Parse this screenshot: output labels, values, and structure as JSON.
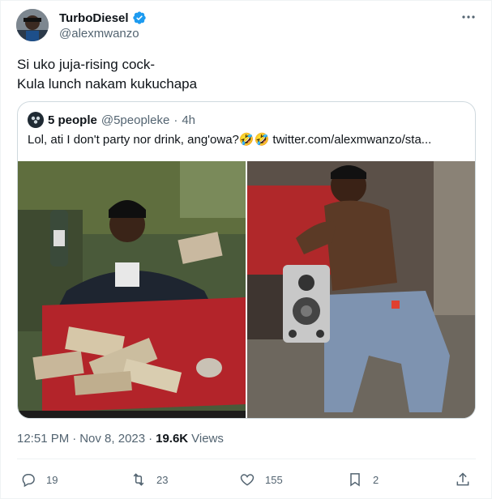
{
  "tweet": {
    "author": {
      "name": "TurboDiesel",
      "handle": "@alexmwanzo",
      "verified": true
    },
    "text_lines": [
      "Si uko juja-rising cock-",
      "Kula lunch nakam kukuchapa"
    ],
    "quote": {
      "author_name": "5 people",
      "author_handle": "@5peopleke",
      "separator": "·",
      "time": "4h",
      "text": "Lol, ati I don't party nor drink, ang'owa?🤣🤣 twitter.com/alexmwanzo/sta..."
    },
    "meta": {
      "time": "12:51 PM",
      "sep1": "·",
      "date": "Nov 8, 2023",
      "sep2": "·",
      "views_count": "19.6K",
      "views_label": "Views"
    },
    "actions": {
      "replies": "19",
      "retweets": "23",
      "likes": "155",
      "bookmarks": "2"
    }
  },
  "colors": {
    "text_primary": "#0f1419",
    "text_secondary": "#536471",
    "verified": "#1d9bf0",
    "border": "#cfd9de"
  },
  "icons": [
    "more-icon",
    "verified-icon",
    "reply-icon",
    "retweet-icon",
    "like-icon",
    "bookmark-icon",
    "share-icon"
  ]
}
